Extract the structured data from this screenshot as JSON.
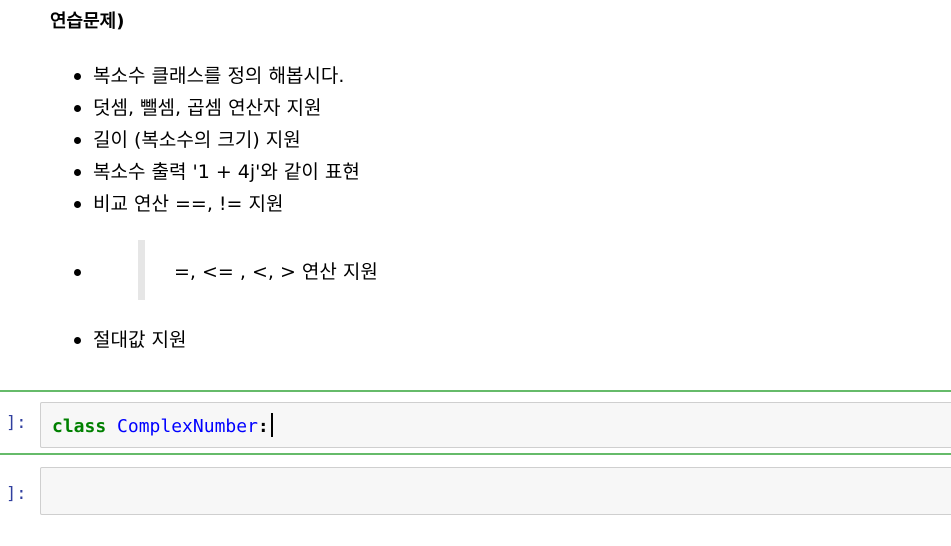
{
  "markdown": {
    "heading": "연습문제)",
    "items": [
      {
        "text": "복소수 클래스를 정의 해봅시다."
      },
      {
        "text": "덧셈, 뺄셈, 곱셈 연산자 지원"
      },
      {
        "text": "길이 (복소수의 크기) 지원"
      },
      {
        "text": "복소수 출력 '1 + 4j'와 같이 표현"
      },
      {
        "text": "비교 연산 ==, != 지원"
      },
      {
        "text": "=, <= , <, > 연산 지원"
      },
      {
        "text": "절대값 지원"
      }
    ]
  },
  "cells": [
    {
      "prompt": "]:",
      "code": {
        "keyword": "class",
        "name": "ComplexNumber",
        "punct": ":"
      }
    },
    {
      "prompt": "]:",
      "code": {}
    }
  ],
  "colors": {
    "selected_border": "#66bb6a",
    "prompt": "#303f9f",
    "keyword": "#008000",
    "class_name": "#0000ff"
  }
}
